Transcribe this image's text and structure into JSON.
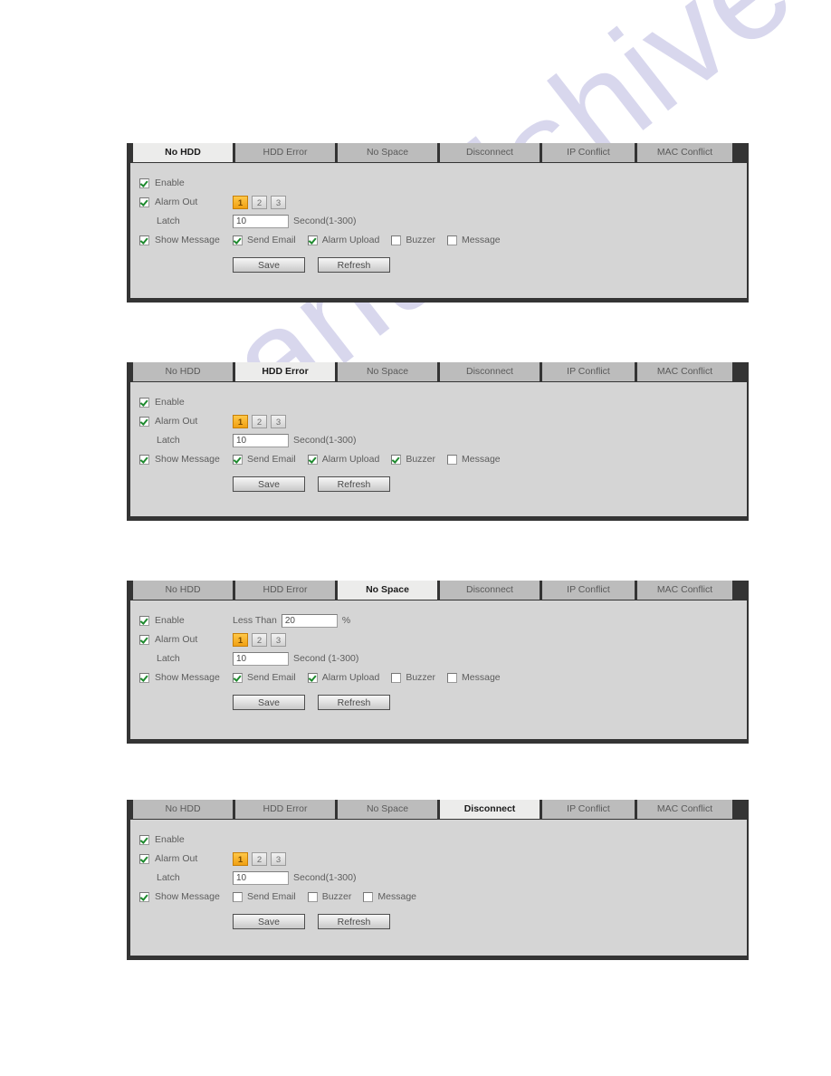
{
  "watermark": {
    "text": "manualshive.com"
  },
  "tabs": [
    "No HDD",
    "HDD Error",
    "No Space",
    "Disconnect",
    "IP Conflict",
    "MAC Conflict"
  ],
  "common": {
    "enable_label": "Enable",
    "alarm_out_label": "Alarm Out",
    "latch_label": "Latch",
    "show_message_label": "Show Message",
    "send_email_label": "Send Email",
    "alarm_upload_label": "Alarm Upload",
    "buzzer_label": "Buzzer",
    "message_label": "Message",
    "save_label": "Save",
    "refresh_label": "Refresh",
    "alarm_out_buttons": [
      "1",
      "2",
      "3"
    ],
    "latch_value": "10",
    "less_than_label": "Less Than",
    "percent_label": "%",
    "colors": {
      "panel_bg": "#d5d5d5",
      "tab_bar": "#343434",
      "tab_inactive": "#bcbcbc",
      "tab_active": "#ececeb",
      "alarm_selected": "#f0a013",
      "check_green": "#1e8a2e"
    }
  },
  "panels": [
    {
      "id": "no-hdd",
      "active_tab": "No HDD",
      "active_index": 0,
      "enable": true,
      "alarm_out": true,
      "alarm_out_selected": "1",
      "latch_value": "10",
      "latch_unit": "Second(1-300)",
      "show_message": true,
      "has_less_than": false,
      "checks": [
        {
          "label": "Send Email",
          "checked": true
        },
        {
          "label": "Alarm Upload",
          "checked": true
        },
        {
          "label": "Buzzer",
          "checked": false
        },
        {
          "label": "Message",
          "checked": false
        }
      ]
    },
    {
      "id": "hdd-error",
      "active_tab": "HDD Error",
      "active_index": 1,
      "enable": true,
      "alarm_out": true,
      "alarm_out_selected": "1",
      "latch_value": "10",
      "latch_unit": "Second(1-300)",
      "show_message": true,
      "has_less_than": false,
      "checks": [
        {
          "label": "Send Email",
          "checked": true
        },
        {
          "label": "Alarm Upload",
          "checked": true
        },
        {
          "label": "Buzzer",
          "checked": true
        },
        {
          "label": "Message",
          "checked": false
        }
      ]
    },
    {
      "id": "no-space",
      "active_tab": "No Space",
      "active_index": 2,
      "enable": true,
      "alarm_out": true,
      "alarm_out_selected": "1",
      "latch_value": "10",
      "latch_unit": "Second (1-300)",
      "show_message": true,
      "has_less_than": true,
      "less_than_label": "Less Than",
      "less_than_value": "20",
      "less_than_unit": "%",
      "checks": [
        {
          "label": "Send Email",
          "checked": true
        },
        {
          "label": "Alarm Upload",
          "checked": true
        },
        {
          "label": "Buzzer",
          "checked": false
        },
        {
          "label": "Message",
          "checked": false
        }
      ]
    },
    {
      "id": "disconnect",
      "active_tab": "Disconnect",
      "active_index": 3,
      "enable": true,
      "alarm_out": true,
      "alarm_out_selected": "1",
      "latch_value": "10",
      "latch_unit": "Second(1-300)",
      "show_message": true,
      "has_less_than": false,
      "checks": [
        {
          "label": "Send Email",
          "checked": false
        },
        {
          "label": "Buzzer",
          "checked": false
        },
        {
          "label": "Message",
          "checked": false
        }
      ]
    }
  ]
}
